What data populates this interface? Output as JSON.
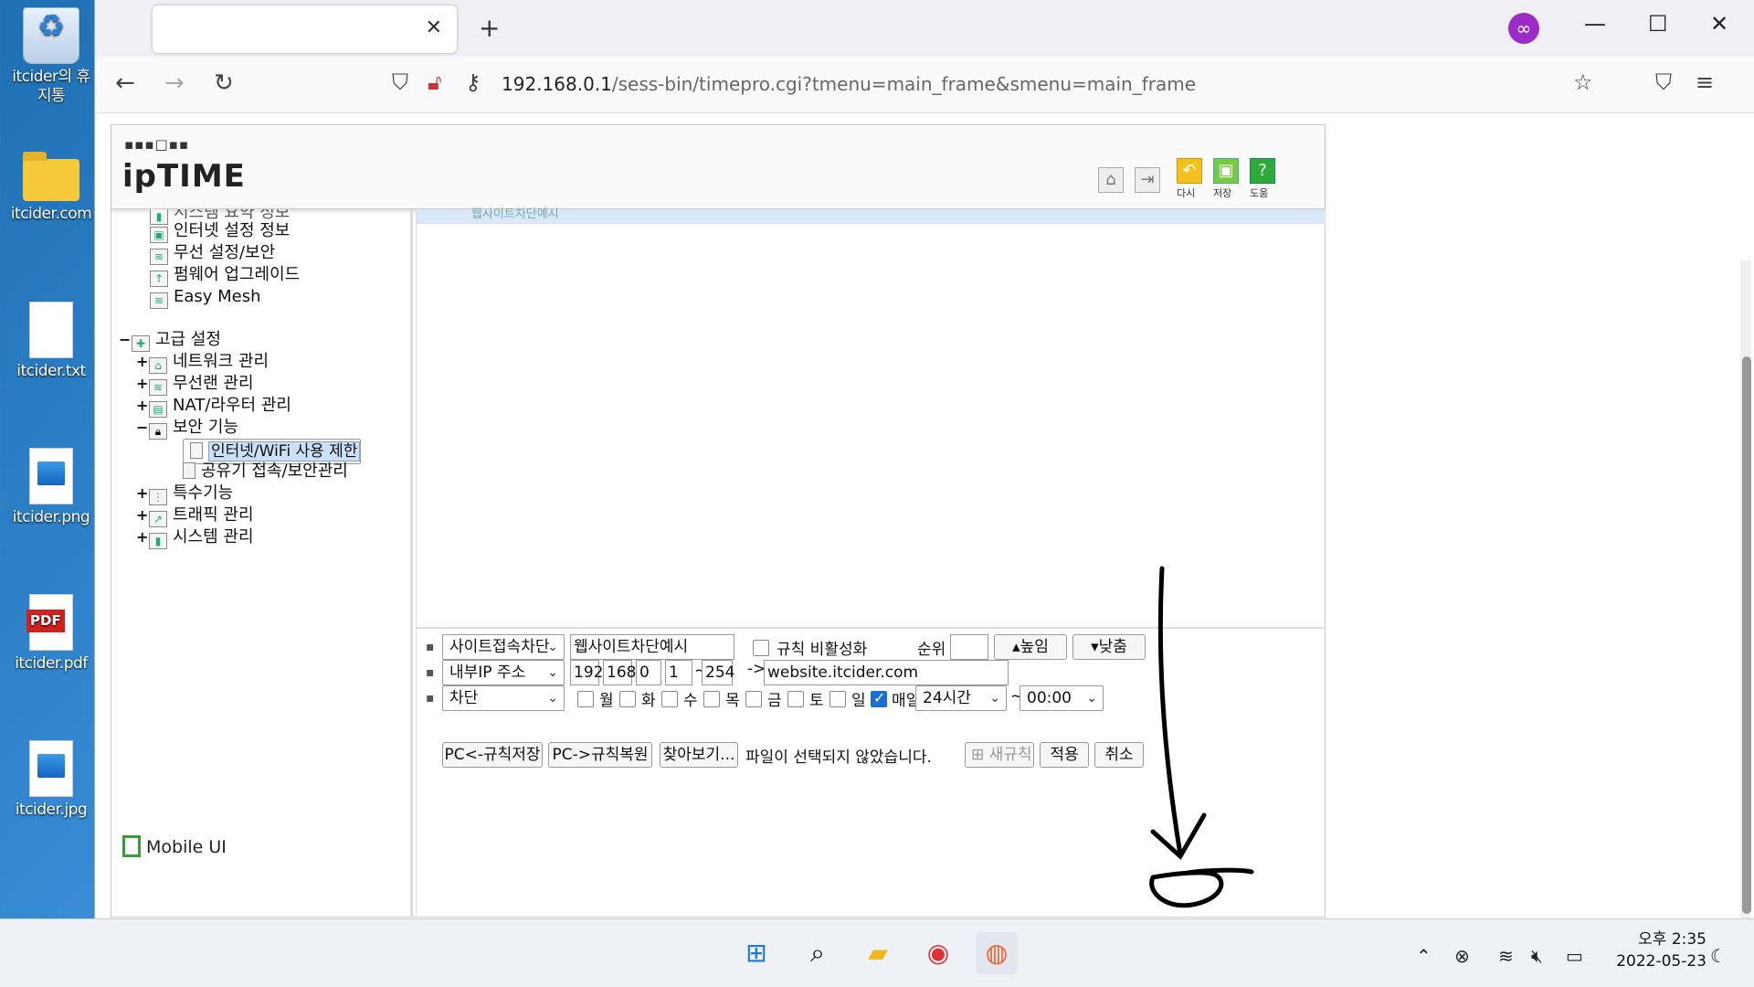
{
  "desktop": {
    "icons": [
      {
        "label": "itcider의 휴지통",
        "icon": "recycle-bin-icon"
      },
      {
        "label": "itcider.com",
        "icon": "folder-icon"
      },
      {
        "label": "itcider.txt",
        "icon": "text-file-icon"
      },
      {
        "label": "itcider.png",
        "icon": "image-file-icon"
      },
      {
        "label": "itcider.pdf",
        "icon": "pdf-file-icon"
      },
      {
        "label": "itcider.jpg",
        "icon": "image-file-icon"
      }
    ]
  },
  "browser": {
    "tab_title": "",
    "url_host": "192.168.0.1",
    "url_path": "/sess-bin/timepro.cgi?tmenu=main_frame&smenu=main_frame"
  },
  "router": {
    "brand_dots": "▪▪▪□▪▪",
    "brand": "ipTIME",
    "toolbar": {
      "retry": "다시",
      "save": "저장",
      "help": "도움"
    },
    "tree": {
      "basic_items": [
        "시스템 요약 정보",
        "인터넷 설정 정보",
        "무선 설정/보안",
        "펌웨어 업그레이드",
        "Easy Mesh"
      ],
      "advanced": "고급 설정",
      "network": "네트워크 관리",
      "wireless": "무선랜 관리",
      "nat": "NAT/라우터 관리",
      "security": "보안 기능",
      "internet_limit": "인터넷/WiFi 사용 제한",
      "router_access": "공유기 접속/보안관리",
      "special": "특수기능",
      "traffic": "트래픽 관리",
      "system": "시스템 관리"
    },
    "mobile_ui": "Mobile UI",
    "form": {
      "rule_type": "사이트접속차단",
      "rule_name": "웹사이트차단예시",
      "disable_rule": "규칙 비활성화",
      "priority_label": "순위",
      "priority_value": "",
      "raise_btn": "▴높임",
      "lower_btn": "▾낮춤",
      "address_type": "내부IP 주소",
      "ip1": "192",
      "ip2": "168",
      "ip3": "0",
      "ip4": "1",
      "ip_end": "254",
      "arrow": "->",
      "site": "website.itcider.com",
      "action": "차단",
      "days": [
        "월",
        "화",
        "수",
        "목",
        "금",
        "토",
        "일"
      ],
      "everyday": "매일",
      "everyday_checked": true,
      "time_mode": "24시간",
      "tilde": "~",
      "time_value": "00:00",
      "save_rules": "PC<-규칙저장",
      "restore_rules": "PC->규칙복원",
      "browse": "찾아보기...",
      "no_file": "파일이 선택되지 않았습니다.",
      "new_rule": "새규칙",
      "apply": "적용",
      "cancel": "취소"
    }
  },
  "taskbar": {
    "time": "오후 2:35",
    "date": "2022-05-23"
  }
}
